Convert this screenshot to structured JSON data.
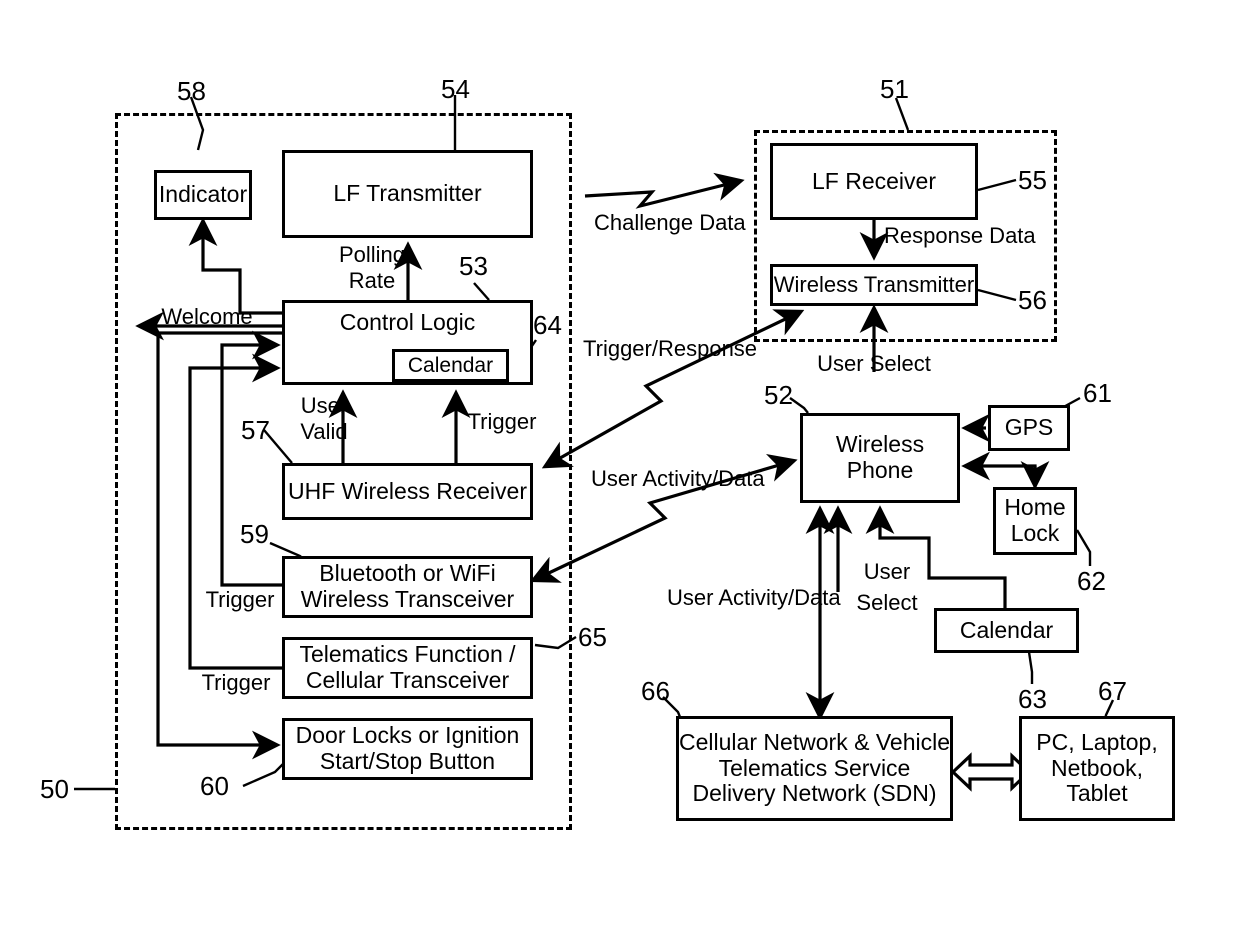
{
  "figure": {
    "title": "Vehicle passive entry / wireless phone telematics block diagram",
    "line_color": "#000000",
    "background": "#ffffff"
  },
  "regions": {
    "vehicle": {
      "ref": "50",
      "style": "dashed"
    },
    "fob": {
      "ref": "51",
      "style": "dashed"
    }
  },
  "blocks": {
    "indicator": {
      "label": "Indicator",
      "ref": "58"
    },
    "lf_transmitter": {
      "label": "LF Transmitter",
      "ref": "54"
    },
    "control_logic": {
      "label": "Control Logic",
      "ref": "53"
    },
    "calendar_vehicle": {
      "label": "Calendar",
      "ref": "64"
    },
    "uhf_receiver": {
      "label": "UHF Wireless Receiver",
      "ref": "57"
    },
    "bt_wifi": {
      "label": "Bluetooth or WiFi\nWireless Transceiver",
      "line1": "Bluetooth or WiFi",
      "line2": "Wireless Transceiver",
      "ref": "59"
    },
    "telematics": {
      "line1": "Telematics Function /",
      "line2": "Cellular Transceiver",
      "ref": "65"
    },
    "door_locks": {
      "line1": "Door Locks or Ignition",
      "line2": "Start/Stop Button",
      "ref": "60"
    },
    "lf_receiver": {
      "label": "LF Receiver",
      "ref": "55"
    },
    "wireless_transmitter": {
      "label": "Wireless Transmitter",
      "ref": "56"
    },
    "wireless_phone": {
      "line1": "Wireless",
      "line2": "Phone",
      "ref": "52"
    },
    "gps": {
      "label": "GPS",
      "ref": "61"
    },
    "home_lock": {
      "line1": "Home",
      "line2": "Lock",
      "ref": "62"
    },
    "calendar_phone": {
      "label": "Calendar",
      "ref": "63"
    },
    "sdn": {
      "line1": "Cellular Network & Vehicle",
      "line2": "Telematics Service",
      "line3": "Delivery Network (SDN)",
      "ref": "66"
    },
    "pc": {
      "line1": "PC, Laptop,",
      "line2": "Netbook,",
      "line3": "Tablet",
      "ref": "67"
    }
  },
  "edge_labels": {
    "polling_rate_l1": "Polling",
    "polling_rate_l2": "Rate",
    "welcome": "Welcome",
    "user_valid_l1": "User",
    "user_valid_l2": "Valid",
    "trigger_cl": "Trigger",
    "trigger_bt": "Trigger",
    "trigger_tel": "Trigger",
    "challenge_data": "Challenge Data",
    "response_data": "Response Data",
    "user_select_fob": "User Select",
    "trigger_response": "Trigger/Response",
    "user_activity_data_upper": "User Activity/Data",
    "user_activity_data_lower": "User Activity/Data",
    "user_select_phone_l1": "User",
    "user_select_phone_l2": "Select"
  },
  "ref_numbers": [
    "50",
    "51",
    "52",
    "53",
    "54",
    "55",
    "56",
    "57",
    "58",
    "59",
    "60",
    "61",
    "62",
    "63",
    "64",
    "65",
    "66",
    "67"
  ]
}
